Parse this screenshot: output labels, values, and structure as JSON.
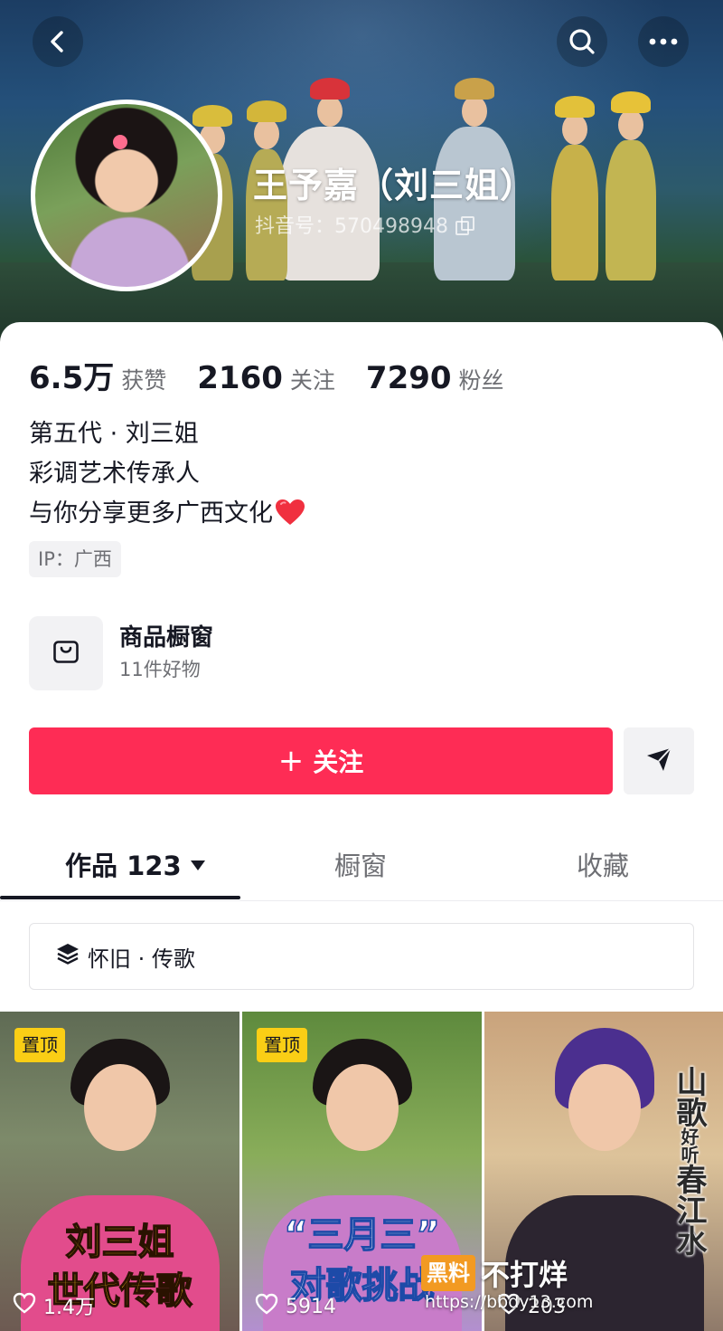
{
  "header": {
    "name": "王予嘉（刘三姐）",
    "douyin_id": "抖音号：570498948"
  },
  "stats": [
    {
      "value": "6.5万",
      "label": "获赞"
    },
    {
      "value": "2160",
      "label": "关注"
    },
    {
      "value": "7290",
      "label": "粉丝"
    }
  ],
  "bio": {
    "line1": "第五代 · 刘三姐",
    "line2": "彩调艺术传承人",
    "line3": "与你分享更多广西文化"
  },
  "ip_tag": "IP：广西",
  "shop": {
    "title": "商品橱窗",
    "subtitle": "11件好物"
  },
  "actions": {
    "follow_plus": "+",
    "follow_label": "关注"
  },
  "tabs": [
    {
      "label": "作品 123"
    },
    {
      "label": "橱窗"
    },
    {
      "label": "收藏"
    }
  ],
  "collection": {
    "label": "怀旧 · 传歌"
  },
  "videos": [
    {
      "pin": "置顶",
      "title_line1": "刘三姐",
      "title_line2": "世代传歌",
      "likes": "1.4万"
    },
    {
      "pin": "置顶",
      "title_line1": "“三月三”",
      "title_line2": "对歌挑战",
      "likes": "5914"
    },
    {
      "vertical_title": "山歌",
      "vertical_small": "好听",
      "vertical_title2": "春江水",
      "likes": "203"
    }
  ],
  "watermark": {
    "logo": "黑料",
    "text": "不打烊",
    "url": "https://bbdy13.com"
  },
  "colors": {
    "accent": "#fe2c55",
    "pin": "#face15",
    "text_primary": "#161823",
    "text_secondary": "#6e6f74"
  },
  "icons": {
    "back": "back-arrow-icon",
    "search": "search-icon",
    "more": "more-icon",
    "copy": "copy-icon",
    "shop": "shopping-bag-icon",
    "share": "send-icon",
    "collection": "layers-icon",
    "heart": "heart-icon"
  }
}
